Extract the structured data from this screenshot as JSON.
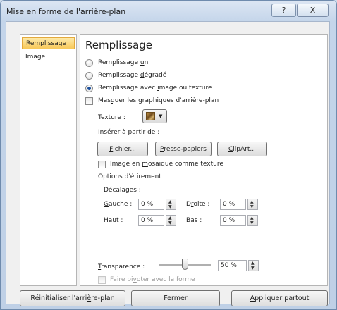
{
  "window": {
    "title": "Mise en forme de l'arrière-plan",
    "help_glyph": "?",
    "close_glyph": "X"
  },
  "nav": {
    "items": [
      {
        "label": "Remplissage",
        "selected": true
      },
      {
        "label": "Image",
        "selected": false
      }
    ]
  },
  "fill": {
    "heading": "Remplissage",
    "options": [
      {
        "pre": "Remplissage ",
        "key": "u",
        "post": "ni",
        "checked": false
      },
      {
        "pre": "Remplissage ",
        "key": "d",
        "post": "égradé",
        "checked": false
      },
      {
        "pre": "Remplissage avec ",
        "key": "i",
        "post": "mage ou texture",
        "checked": true
      }
    ],
    "hide_graphics": {
      "pre": "Mas",
      "key": "q",
      "post": "uer les graphiques d'arrière-plan",
      "checked": false
    },
    "texture": {
      "pre": "T",
      "key": "e",
      "post": "xture :",
      "dropdown_glyph": "▼"
    },
    "insert_from": "Insérer à partir de :",
    "buttons": [
      {
        "pre": "",
        "key": "F",
        "post": "ichier..."
      },
      {
        "pre": "",
        "key": "P",
        "post": "resse-papiers"
      },
      {
        "pre": "",
        "key": "C",
        "post": "lipArt..."
      }
    ],
    "tile": {
      "pre": "Image en ",
      "key": "m",
      "post": "osaïque comme texture",
      "checked": false
    },
    "stretch_options": "Options d'étirement",
    "offsets_label": "Décalages :",
    "offsets": {
      "left": {
        "pre": "",
        "key": "G",
        "post": "auche :",
        "value": "0 %"
      },
      "right": {
        "pre": "D",
        "key": "r",
        "post": "oite :",
        "value": "0 %"
      },
      "top": {
        "pre": "",
        "key": "H",
        "post": "aut :",
        "value": "0 %"
      },
      "bottom": {
        "pre": "",
        "key": "B",
        "post": "as :",
        "value": "0 %"
      }
    },
    "transparency": {
      "pre": "",
      "key": "T",
      "post": "ransparence :",
      "value": "50 %",
      "level": 0.5
    },
    "rotate": {
      "pre": "Faire pi",
      "key": "v",
      "post": "oter avec la forme",
      "checked": false,
      "disabled": true
    }
  },
  "footer": {
    "reset": {
      "pre": "Réinitialiser l'arri",
      "key": "è",
      "post": "re-plan"
    },
    "close": "Fermer",
    "apply_all": {
      "pre": "",
      "key": "A",
      "post": "ppliquer partout"
    }
  },
  "colors": {
    "accent": "#f8c95a",
    "title_bg": "#c4d5ea",
    "radio_dot": "#1b4f9c"
  }
}
